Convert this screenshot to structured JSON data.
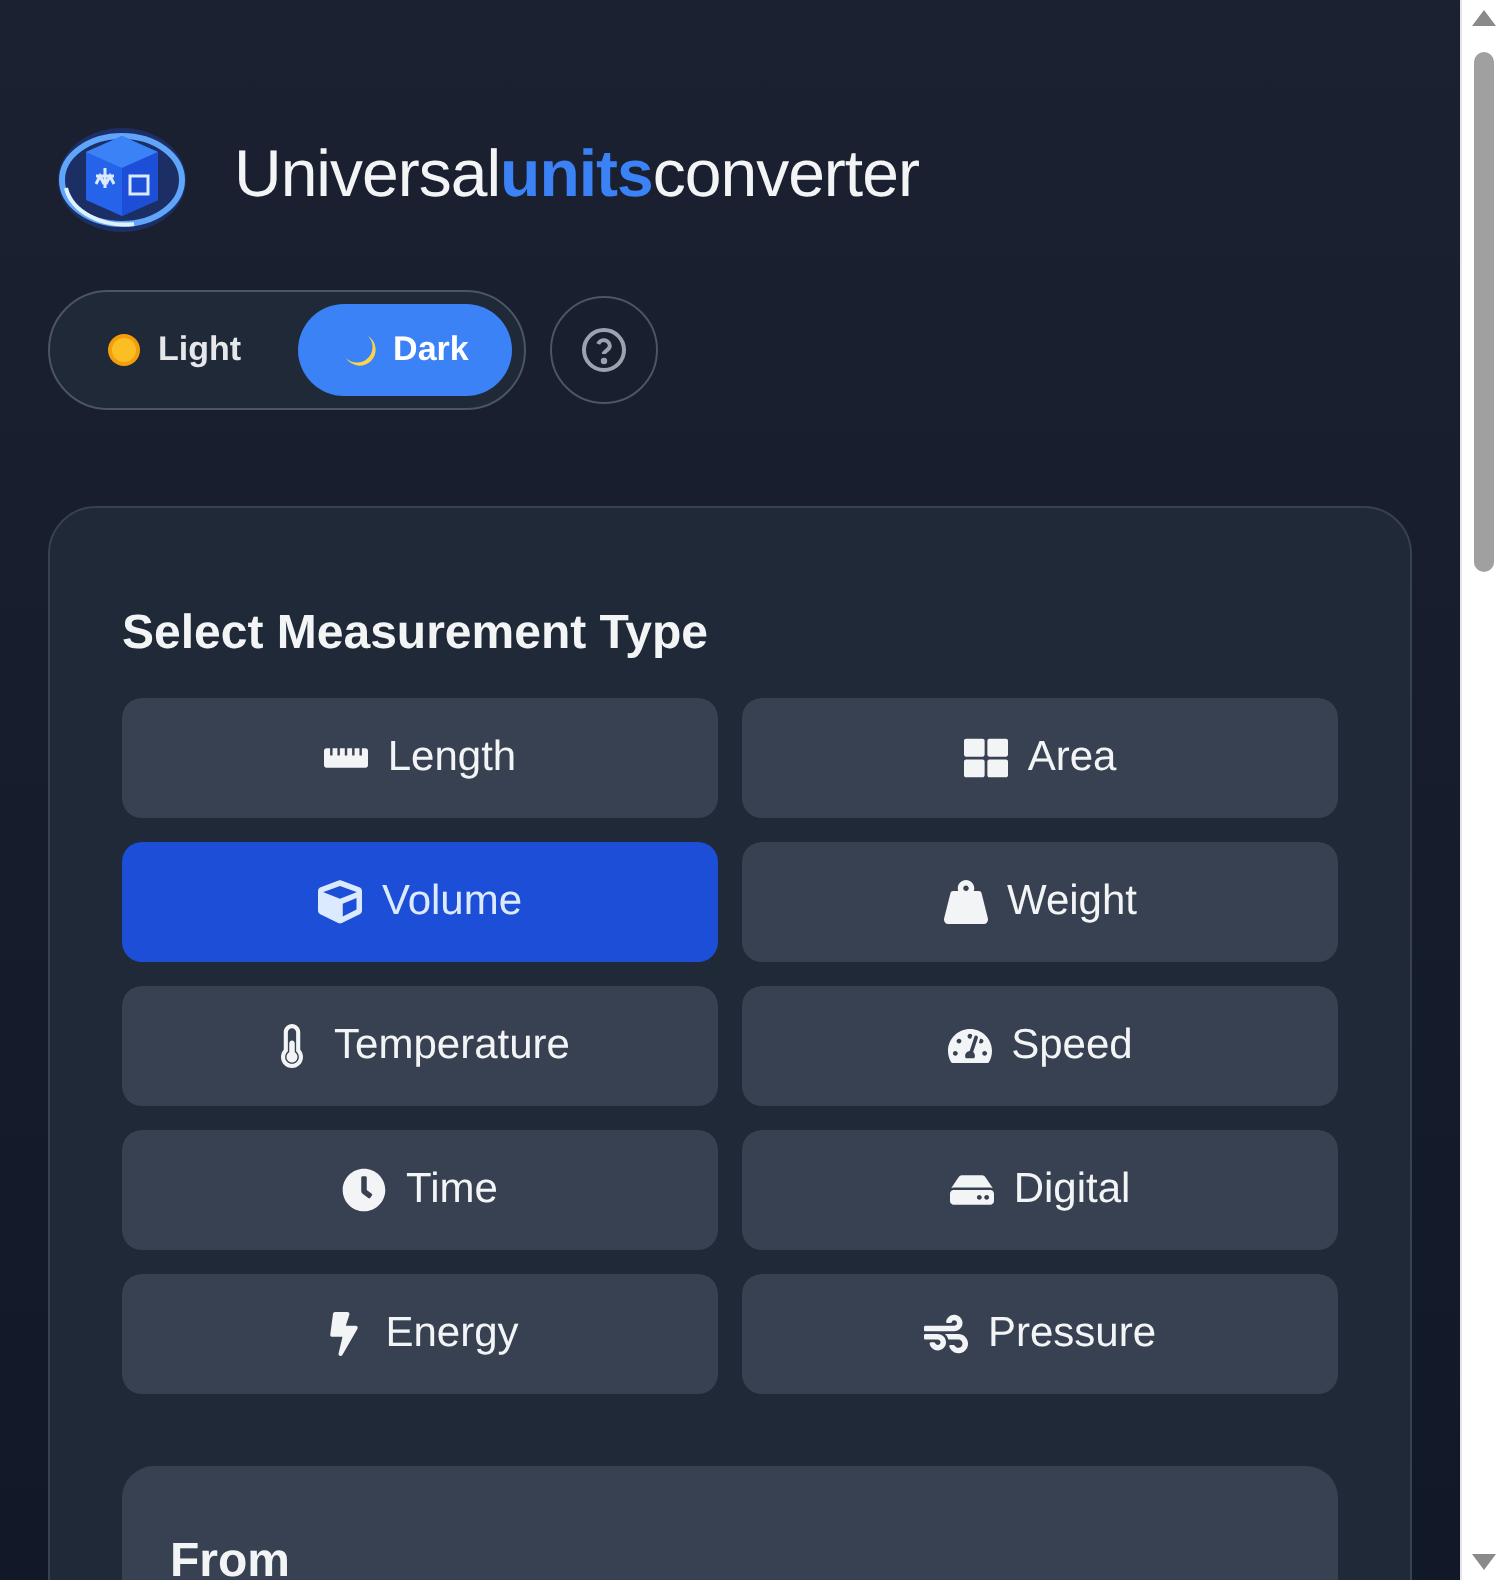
{
  "header": {
    "title_parts": [
      {
        "text": "Universal",
        "accent": false
      },
      {
        "text": "units",
        "accent": true
      },
      {
        "text": "converter",
        "accent": false
      }
    ]
  },
  "theme_toggle": [
    {
      "label": "Light",
      "kind": "sun",
      "selected": false
    },
    {
      "label": "Dark",
      "kind": "moon",
      "selected": true
    }
  ],
  "card": {
    "heading": "Select Measurement Type",
    "types": [
      {
        "label": "Length",
        "kind": "ruler",
        "selected": false
      },
      {
        "label": "Area",
        "kind": "grid",
        "selected": false
      },
      {
        "label": "Volume",
        "kind": "cube",
        "selected": true
      },
      {
        "label": "Weight",
        "kind": "weight",
        "selected": false
      },
      {
        "label": "Temperature",
        "kind": "thermometer",
        "selected": false
      },
      {
        "label": "Speed",
        "kind": "gauge",
        "selected": false
      },
      {
        "label": "Time",
        "kind": "clock",
        "selected": false
      },
      {
        "label": "Digital",
        "kind": "drive",
        "selected": false
      },
      {
        "label": "Energy",
        "kind": "bolt",
        "selected": false
      },
      {
        "label": "Pressure",
        "kind": "wind",
        "selected": false
      }
    ],
    "from_panel": {
      "label": "From"
    }
  }
}
